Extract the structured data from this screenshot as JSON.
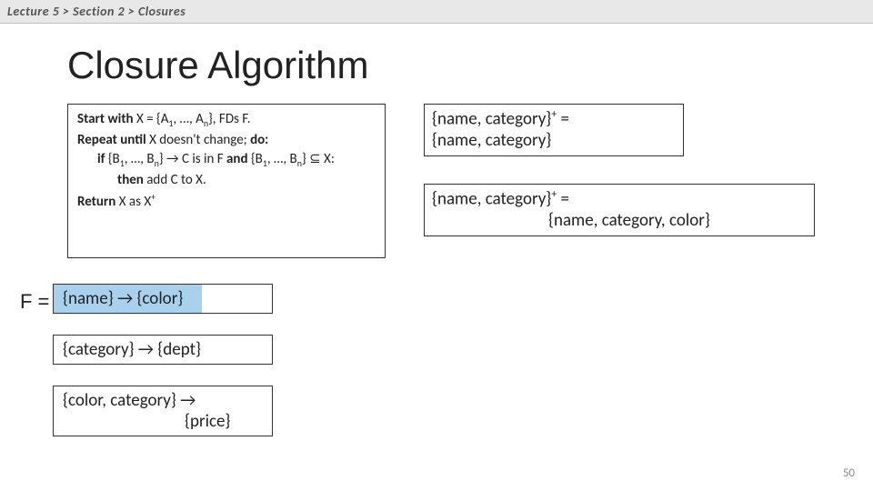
{
  "breadcrumb": "Lecture 5  >  Section 2  >  Closures",
  "title": "Closure Algorithm",
  "algo": {
    "l1_pre": "Start with",
    "l1_math": " X = {A",
    "l1_sub1": "1",
    "l1_mid": ", …, A",
    "l1_subn": "n",
    "l1_post": "}, FDs F.",
    "l2_pre": "Repeat until",
    "l2_mid": " X doesn't change; ",
    "l2_post": "do:",
    "l3_pre": "if",
    "l3_math1": " {B",
    "l3_sub1": "1",
    "l3_mid": ", …, B",
    "l3_subn": "n",
    "l3_arrow": "} → C is in F ",
    "l3_and": "and",
    "l3_tail": " {B",
    "l3_tail_sub1": "1",
    "l4_pre": ", …, B",
    "l4_subn": "n",
    "l4_post": "} ⊆ X:",
    "l5_pre": "then",
    "l5_post": "  add C to X.",
    "l6_pre": "Return",
    "l6_post": " X as X",
    "l6_sup": "+"
  },
  "closure1": {
    "line1a": "{name, category}",
    "line1sup": "+",
    "line1b": " = ",
    "line2": "{name, category}"
  },
  "closure2": {
    "line1a": "{name, category}",
    "line1sup": "+",
    "line1b": " = ",
    "line2": "{name, category, color}"
  },
  "fLabel": "F =",
  "fd1": "{name} → {color}",
  "fd2": "{category} → {dept}",
  "fd3_a": "{color, category} → ",
  "fd3_b": "{price}",
  "pageNumber": "50"
}
